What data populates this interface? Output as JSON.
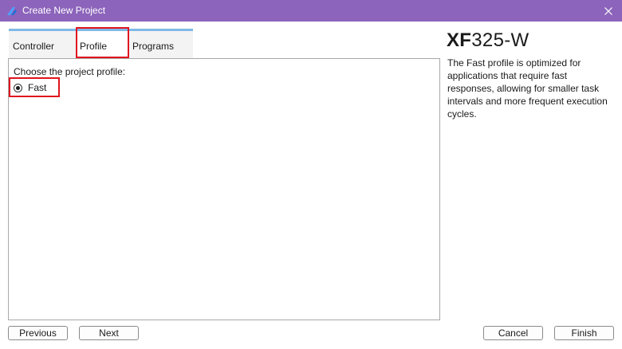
{
  "window": {
    "title": "Create New Project"
  },
  "tabs": [
    {
      "label": "Controller",
      "selected": false
    },
    {
      "label": "Profile",
      "selected": true
    },
    {
      "label": "Programs",
      "selected": false
    }
  ],
  "panel": {
    "prompt": "Choose the project profile:",
    "options": [
      {
        "label": "Fast",
        "checked": true
      }
    ]
  },
  "side": {
    "model_bold": "XF",
    "model_rest": "325-W",
    "description": "The Fast profile is optimized for applications that require fast responses, allowing for smaller task intervals and more frequent execution cycles."
  },
  "buttons": {
    "previous": "Previous",
    "next": "Next",
    "cancel": "Cancel",
    "finish": "Finish"
  },
  "colors": {
    "titlebar": "#8c64bb",
    "tab_accent": "#7fb9e8",
    "highlight": "#e0141e"
  }
}
